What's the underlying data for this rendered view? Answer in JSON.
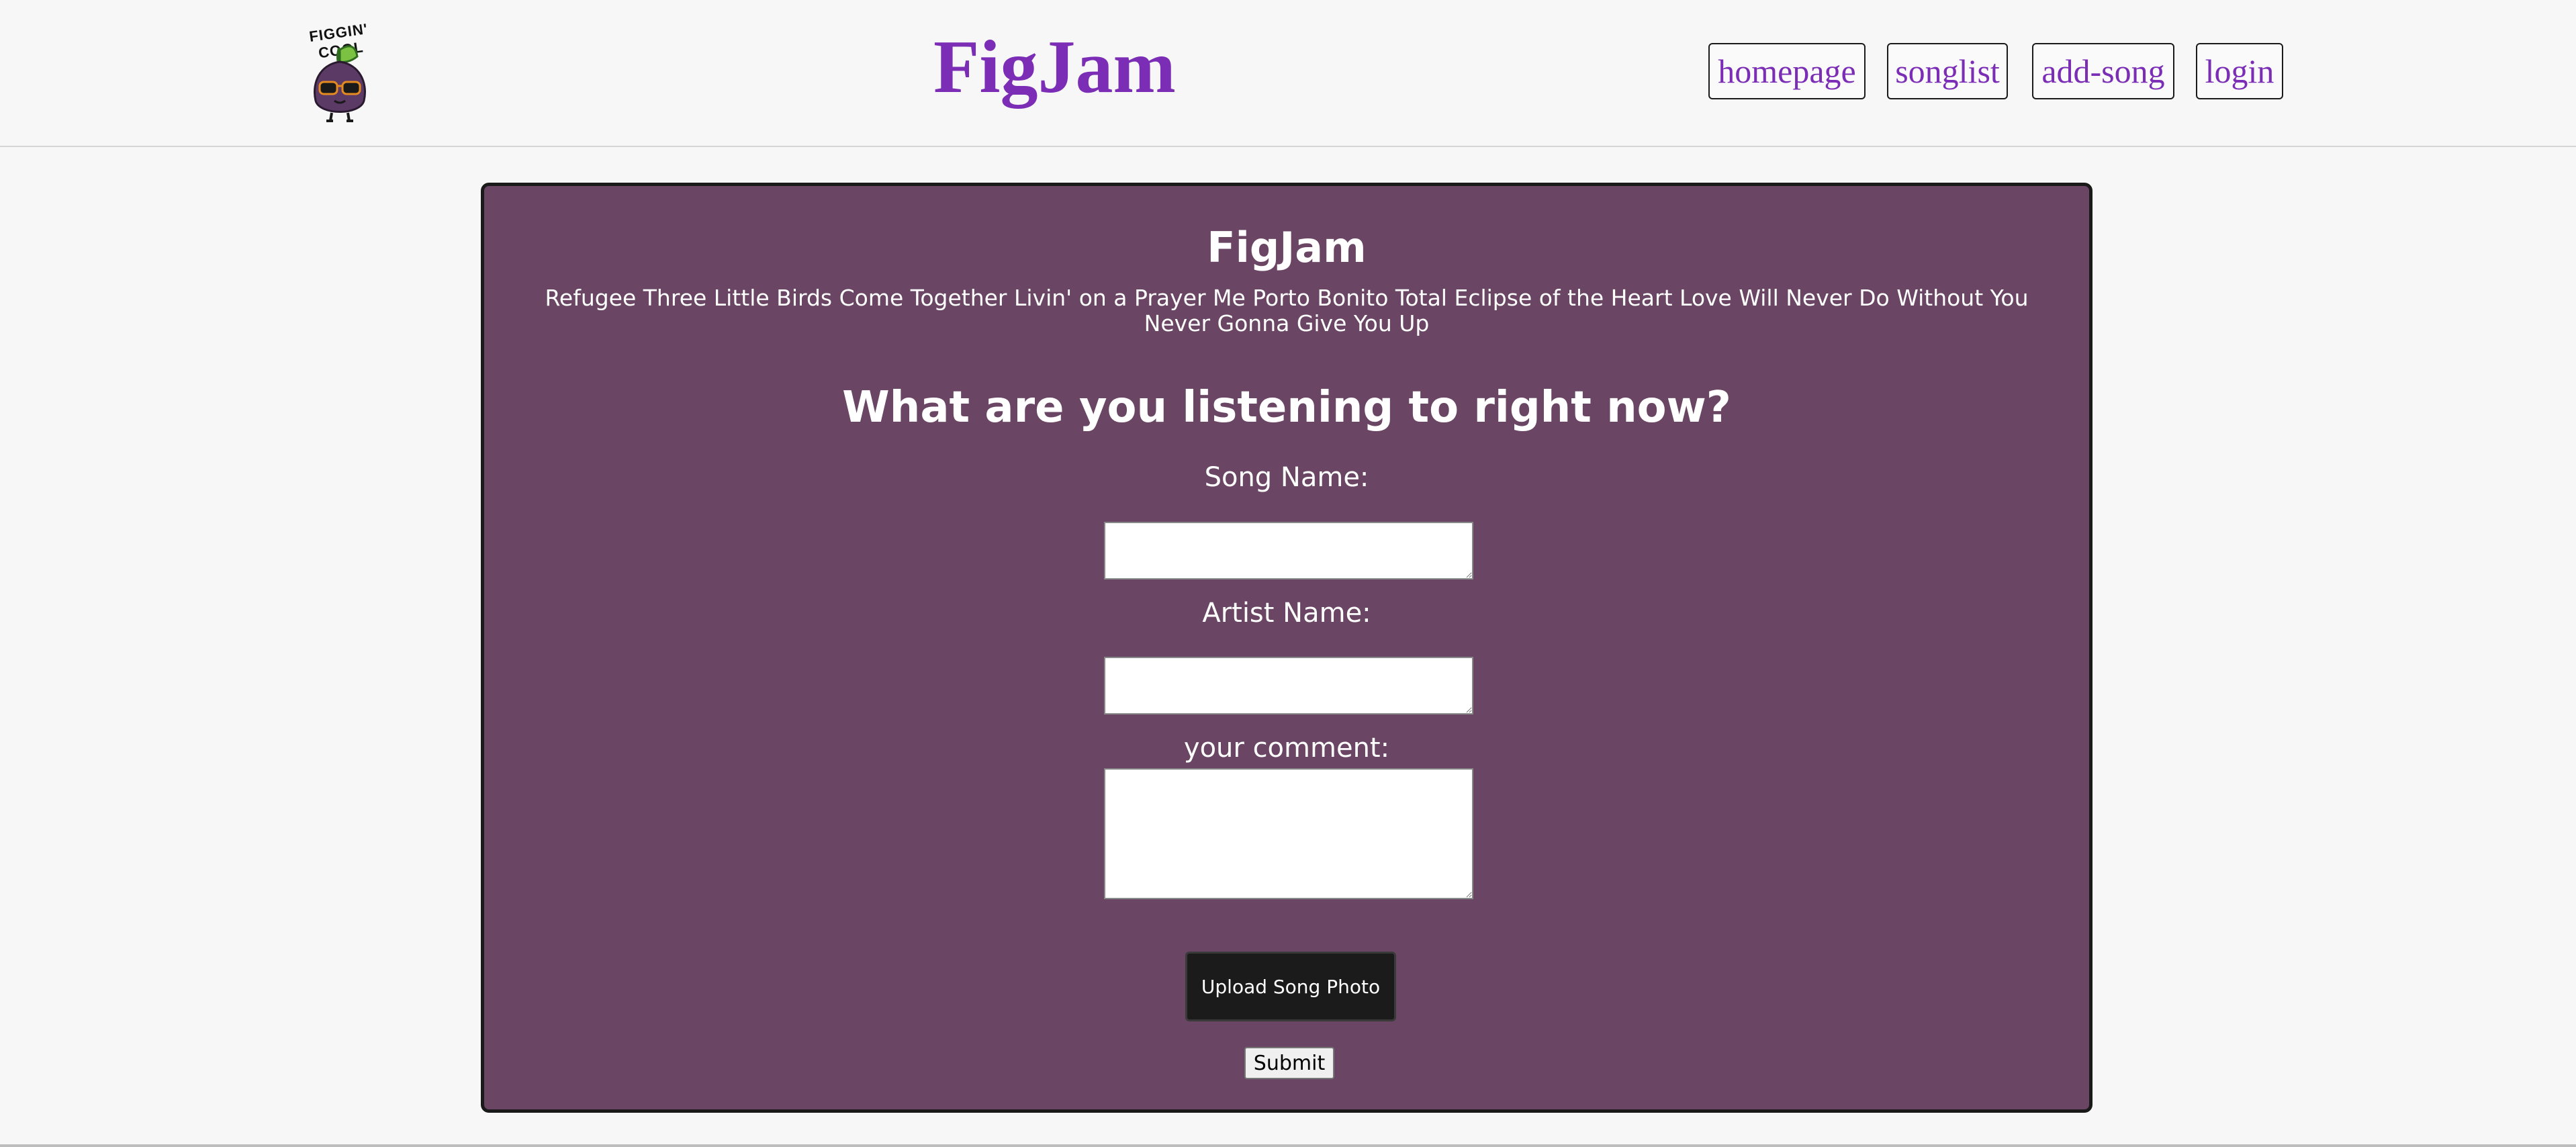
{
  "header": {
    "logo_text": "FIGGIN' COOL",
    "site_title": "FigJam",
    "nav": [
      {
        "label": "homepage"
      },
      {
        "label": "songlist"
      },
      {
        "label": "add-song"
      },
      {
        "label": "login"
      }
    ]
  },
  "panel": {
    "title": "FigJam",
    "song_list": "Refugee Three Little Birds Come Together Livin' on a Prayer Me Porto Bonito Total Eclipse of the Heart Love Will Never Do Without You Never Gonna Give You Up",
    "question": "What are you listening to right now?",
    "form": {
      "song_name_label": "Song Name:",
      "song_name_value": "",
      "artist_name_label": "Artist Name:",
      "artist_name_value": "",
      "comment_label": "your comment:",
      "comment_value": "",
      "upload_label": "Upload Song Photo",
      "submit_label": "Submit"
    }
  },
  "colors": {
    "brand": "#7b2db5",
    "panel_bg": "#6b4664",
    "page_bg": "#f7f7f7"
  }
}
